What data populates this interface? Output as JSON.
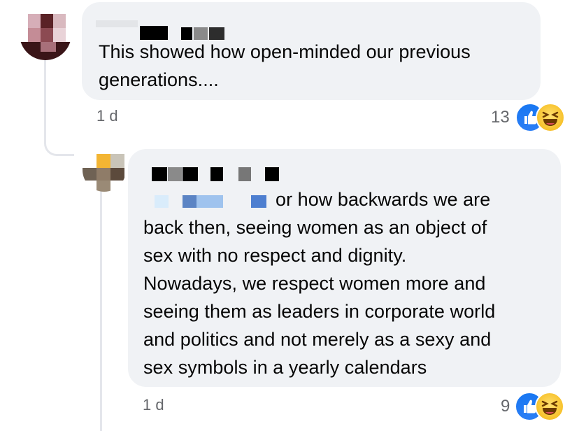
{
  "comments": [
    {
      "text": "This showed how open-minded our previous\ngenerations....",
      "time": "1 d",
      "reaction_count": "13",
      "reactions": [
        "like-icon",
        "haha-icon"
      ]
    },
    {
      "text": "or how backwards we are\nback then, seeing women as an object of\nsex with no respect and dignity.\nNowadays, we respect women more and\nseeing them as leaders in corporate world\nand politics and not merely as a sexy and\nsex symbols in a yearly calendars",
      "time": "1 d",
      "reaction_count": "9",
      "reactions": [
        "like-icon",
        "haha-icon"
      ]
    }
  ],
  "colors": {
    "bubble": "#f0f2f5",
    "meta_text": "#65676b",
    "like": "#1877f2",
    "haha": "#f7c12a",
    "thread_line": "#e4e6eb"
  }
}
